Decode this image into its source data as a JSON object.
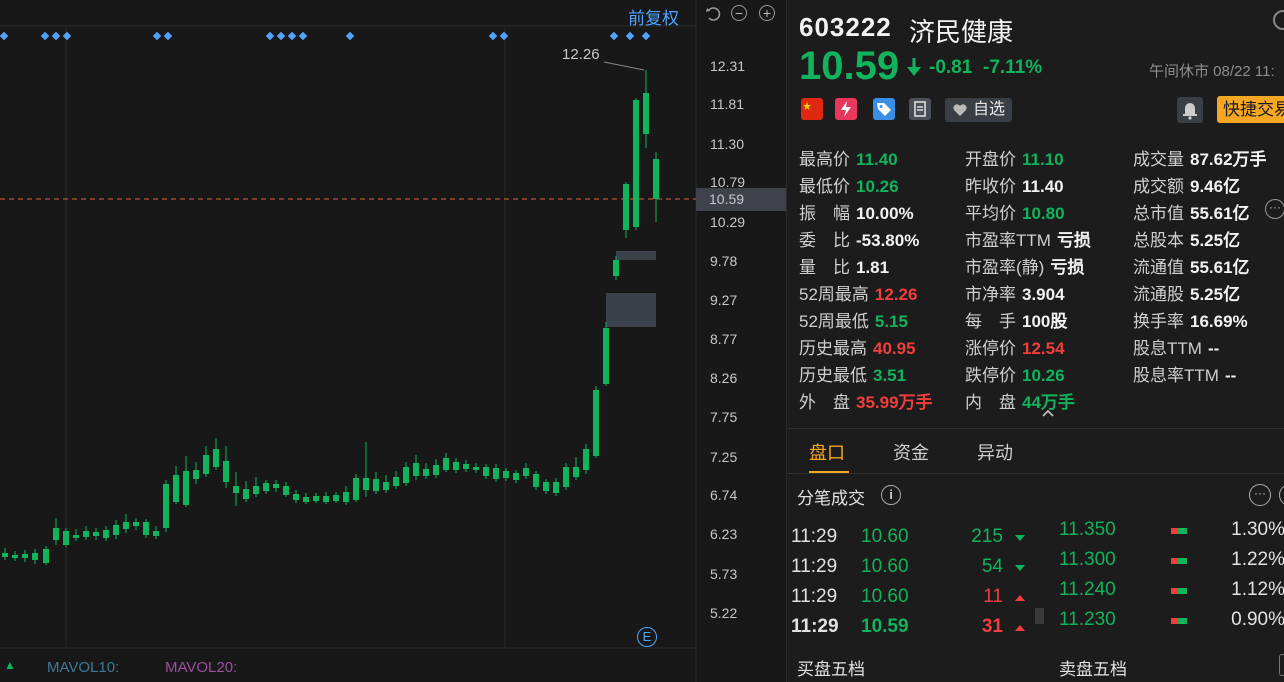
{
  "chart": {
    "adjust_label": "前复权",
    "y_ticks": [
      "12.31",
      "11.81",
      "11.30",
      "10.79",
      "10.59",
      "10.29",
      "9.78",
      "9.27",
      "8.77",
      "8.26",
      "7.75",
      "7.25",
      "6.74",
      "6.23",
      "5.73",
      "5.22"
    ],
    "current_price_tag": "10.59",
    "high_label": "12.26",
    "e_badge": "E",
    "mavol10": "MAVOL10:",
    "mavol20": "MAVOL20:",
    "colors": {
      "up": "#f23d3d",
      "down": "#11b35c",
      "marker": "#4ea4ff"
    }
  },
  "quote": {
    "code": "603222",
    "name": "济民健康",
    "price": "10.59",
    "change": "-0.81",
    "change_pct": "-7.11%",
    "status": "午间休市 08/22 11:",
    "favorite_label": "自选",
    "quick_trade_label": "快捷交易"
  },
  "stats": {
    "col1": [
      {
        "k": "最高价",
        "v": "11.40",
        "c": "green"
      },
      {
        "k": "最低价",
        "v": "10.26",
        "c": "green"
      },
      {
        "k": "振　幅",
        "v": "10.00%",
        "c": "white"
      },
      {
        "k": "委　比",
        "v": "-53.80%",
        "c": "white"
      },
      {
        "k": "量　比",
        "v": "1.81",
        "c": "white"
      },
      {
        "k": "52周最高",
        "v": "12.26",
        "c": "red"
      },
      {
        "k": "52周最低",
        "v": "5.15",
        "c": "green"
      },
      {
        "k": "历史最高",
        "v": "40.95",
        "c": "red"
      },
      {
        "k": "历史最低",
        "v": "3.51",
        "c": "green"
      },
      {
        "k": "外　盘",
        "v": "35.99万手",
        "c": "red"
      }
    ],
    "col2": [
      {
        "k": "开盘价",
        "v": "11.10",
        "c": "green"
      },
      {
        "k": "昨收价",
        "v": "11.40",
        "c": "white"
      },
      {
        "k": "平均价",
        "v": "10.80",
        "c": "green"
      },
      {
        "k": "市盈率TTM",
        "v": "亏损",
        "c": "white"
      },
      {
        "k": "市盈率(静)",
        "v": "亏损",
        "c": "white"
      },
      {
        "k": "市净率",
        "v": "3.904",
        "c": "white"
      },
      {
        "k": "每　手",
        "v": "100股",
        "c": "white"
      },
      {
        "k": "涨停价",
        "v": "12.54",
        "c": "red"
      },
      {
        "k": "跌停价",
        "v": "10.26",
        "c": "green"
      },
      {
        "k": "内　盘",
        "v": "44万手",
        "c": "green"
      }
    ],
    "col3": [
      {
        "k": "成交量",
        "v": "87.62万手",
        "c": "white"
      },
      {
        "k": "成交额",
        "v": "9.46亿",
        "c": "white"
      },
      {
        "k": "总市值",
        "v": "55.61亿",
        "c": "white"
      },
      {
        "k": "总股本",
        "v": "5.25亿",
        "c": "white"
      },
      {
        "k": "流通值",
        "v": "55.61亿",
        "c": "white"
      },
      {
        "k": "流通股",
        "v": "5.25亿",
        "c": "white"
      },
      {
        "k": "换手率",
        "v": "16.69%",
        "c": "white"
      },
      {
        "k": "股息TTM",
        "v": "--",
        "c": "white"
      },
      {
        "k": "股息率TTM",
        "v": "--",
        "c": "white"
      }
    ]
  },
  "tabs": [
    {
      "label": "盘口",
      "active": true
    },
    {
      "label": "资金",
      "active": false
    },
    {
      "label": "异动",
      "active": false
    }
  ],
  "ticks": {
    "title": "分笔成交",
    "rows": [
      {
        "time": "11:29",
        "price": "10.60",
        "vol": "215",
        "dir": "down"
      },
      {
        "time": "11:29",
        "price": "10.60",
        "vol": "54",
        "dir": "down"
      },
      {
        "time": "11:29",
        "price": "10.60",
        "vol": "11",
        "dir": "up"
      },
      {
        "time": "11:29",
        "price": "10.59",
        "vol": "31",
        "dir": "up"
      }
    ]
  },
  "levels": [
    {
      "price": "11.350",
      "pct": "1.30%"
    },
    {
      "price": "11.300",
      "pct": "1.22%"
    },
    {
      "price": "11.240",
      "pct": "1.12%"
    },
    {
      "price": "11.230",
      "pct": "0.90%"
    }
  ],
  "book": {
    "buy_title": "买盘五档",
    "sell_title": "卖盘五档"
  }
}
